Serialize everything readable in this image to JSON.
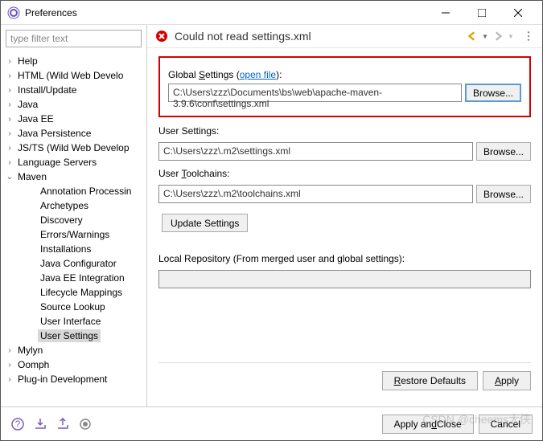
{
  "window": {
    "title": "Preferences"
  },
  "filter_placeholder": "type filter text",
  "tree": [
    {
      "label": "Help",
      "expand": true,
      "indent": 0
    },
    {
      "label": "HTML (Wild Web Develo",
      "expand": true,
      "indent": 0
    },
    {
      "label": "Install/Update",
      "expand": true,
      "indent": 0
    },
    {
      "label": "Java",
      "expand": true,
      "indent": 0
    },
    {
      "label": "Java EE",
      "expand": true,
      "indent": 0
    },
    {
      "label": "Java Persistence",
      "expand": true,
      "indent": 0
    },
    {
      "label": "JS/TS (Wild Web Develop",
      "expand": true,
      "indent": 0
    },
    {
      "label": "Language Servers",
      "expand": true,
      "indent": 0
    },
    {
      "label": "Maven",
      "expand": true,
      "indent": 0,
      "open": true
    },
    {
      "label": "Annotation Processin",
      "expand": false,
      "indent": 1
    },
    {
      "label": "Archetypes",
      "expand": false,
      "indent": 1
    },
    {
      "label": "Discovery",
      "expand": false,
      "indent": 1
    },
    {
      "label": "Errors/Warnings",
      "expand": false,
      "indent": 1
    },
    {
      "label": "Installations",
      "expand": false,
      "indent": 1
    },
    {
      "label": "Java Configurator",
      "expand": false,
      "indent": 1
    },
    {
      "label": "Java EE Integration",
      "expand": false,
      "indent": 1
    },
    {
      "label": "Lifecycle Mappings",
      "expand": false,
      "indent": 1
    },
    {
      "label": "Source Lookup",
      "expand": false,
      "indent": 1
    },
    {
      "label": "User Interface",
      "expand": false,
      "indent": 1
    },
    {
      "label": "User Settings",
      "expand": false,
      "indent": 1,
      "selected": true
    },
    {
      "label": "Mylyn",
      "expand": true,
      "indent": 0
    },
    {
      "label": "Oomph",
      "expand": true,
      "indent": 0
    },
    {
      "label": "Plug-in Development",
      "expand": true,
      "indent": 0
    }
  ],
  "error": {
    "message": "Could not read settings.xml"
  },
  "fields": {
    "global_label_pre": "Global ",
    "global_label_u": "S",
    "global_label_post": "ettings (",
    "open_file": "open file",
    "global_label_end": "):",
    "global_value": "C:\\Users\\zzz\\Documents\\bs\\web\\apache-maven-3.9.6\\conf\\settings.xml",
    "user_label": "User Settings:",
    "user_value": "C:\\Users\\zzz\\.m2\\settings.xml",
    "toolchains_label_pre": "User ",
    "toolchains_label_u": "T",
    "toolchains_label_post": "oolchains:",
    "toolchains_value": "C:\\Users\\zzz\\.m2\\toolchains.xml",
    "local_repo_label": "Local Repository (From merged user and global settings):",
    "local_repo_value": ""
  },
  "buttons": {
    "browse": "Browse...",
    "update": "Update Settings",
    "restore": "Restore Defaults",
    "apply": "Apply",
    "apply_close_pre": "Apply an",
    "apply_close_u": "d",
    "apply_close_post": " Close",
    "cancel": "Cancel"
  },
  "watermark": "CSDN @cheems大侠"
}
